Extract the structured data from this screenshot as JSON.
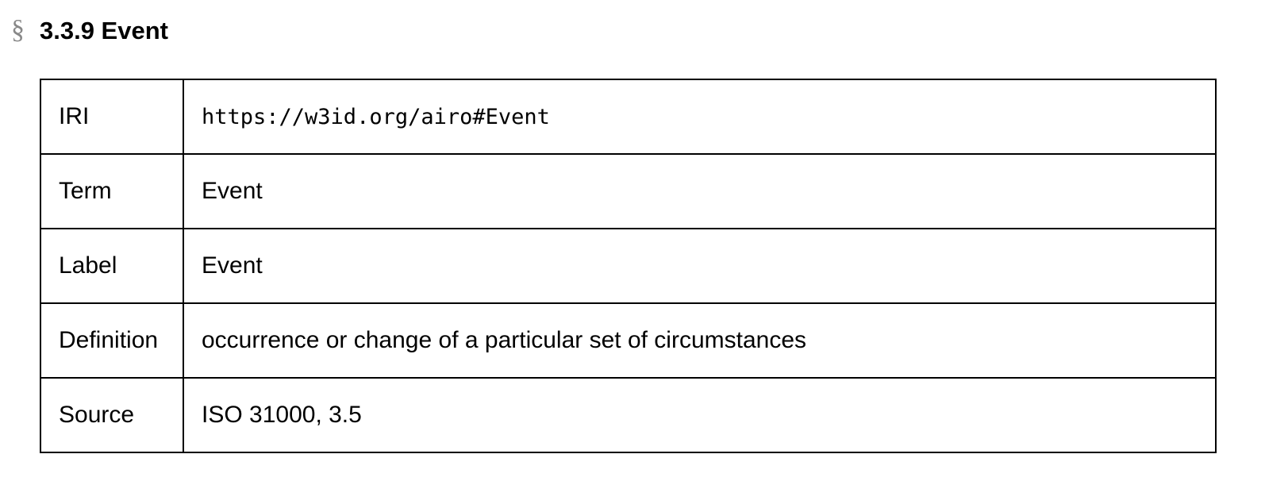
{
  "heading": {
    "anchor_symbol": "§",
    "title": "3.3.9 Event"
  },
  "table": {
    "rows": [
      {
        "key": "IRI",
        "value": "https://w3id.org/airo#Event"
      },
      {
        "key": "Term",
        "value": "Event"
      },
      {
        "key": "Label",
        "value": "Event"
      },
      {
        "key": "Definition",
        "value": "occurrence or change of a particular set of circumstances"
      },
      {
        "key": "Source",
        "value": "ISO 31000, 3.5"
      }
    ]
  }
}
